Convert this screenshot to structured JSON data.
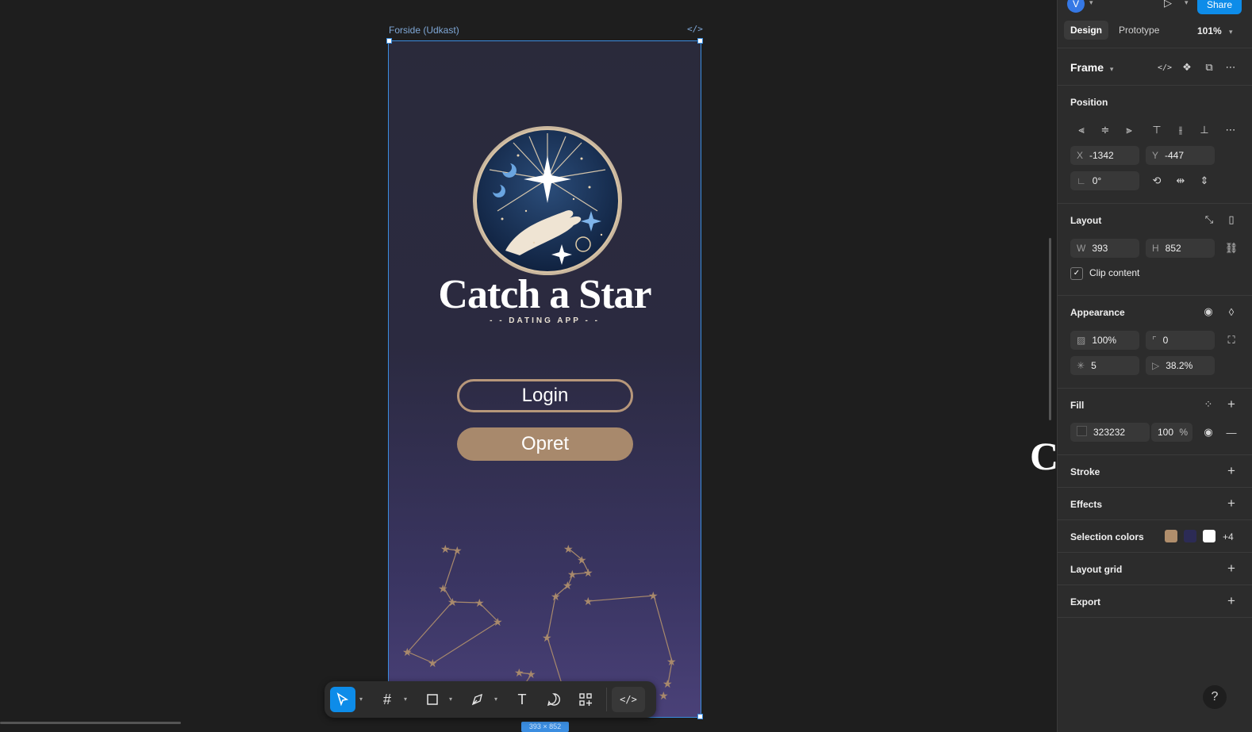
{
  "canvas": {
    "frame_label": "Forside (Udkast)",
    "frame_code_icon": "</>",
    "size_badge": "393 × 852"
  },
  "app_screen": {
    "brand_title": "Catch a Star",
    "brand_subtitle": "- - DATING APP - -",
    "login_label": "Login",
    "opret_label": "Opret",
    "accent_color": "#a8896c",
    "bg_top_color": "#2a2a3b",
    "bg_bottom_color": "#4a4178"
  },
  "toolbar": {
    "tools": [
      "move-tool",
      "frame-tool",
      "shape-tool",
      "pen-tool",
      "text-tool",
      "comment-tool",
      "actions-tool",
      "dev-mode-toggle"
    ]
  },
  "panel": {
    "avatar_initial": "V",
    "share_label": "Share",
    "tabs": {
      "design": "Design",
      "prototype": "Prototype"
    },
    "zoom": "101%",
    "frame_label": "Frame",
    "position": {
      "title": "Position",
      "x_label": "X",
      "x_value": "-1342",
      "y_label": "Y",
      "y_value": "-447",
      "rotation_value": "0°"
    },
    "layout": {
      "title": "Layout",
      "w_label": "W",
      "w_value": "393",
      "h_label": "H",
      "h_value": "852",
      "clip_content_label": "Clip content",
      "clip_content_checked": true
    },
    "appearance": {
      "title": "Appearance",
      "opacity": "100%",
      "corner_radius": "0",
      "points": "5",
      "ratio": "38.2%"
    },
    "fill": {
      "title": "Fill",
      "hex": "323232",
      "opacity": "100",
      "percent_sign": "%"
    },
    "stroke_title": "Stroke",
    "effects_title": "Effects",
    "selection_colors": {
      "title": "Selection colors",
      "swatches": [
        "#b08e6c",
        "#2c2b55",
        "#ffffff"
      ],
      "more": "+4"
    },
    "layout_grid_title": "Layout grid",
    "export_title": "Export",
    "help": "?"
  }
}
